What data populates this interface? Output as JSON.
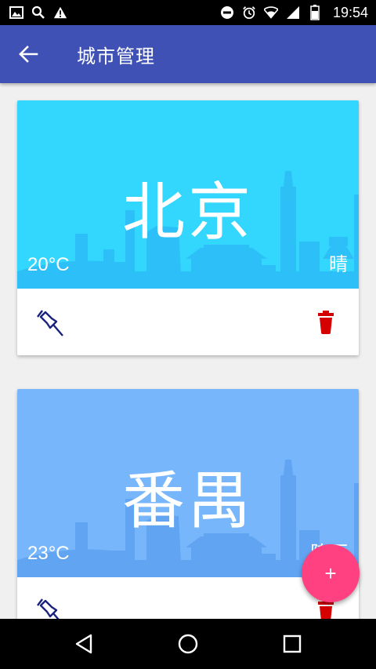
{
  "status_bar": {
    "time": "19:54",
    "left_icons": [
      "image-icon",
      "search-icon",
      "warning-icon"
    ],
    "right_icons": [
      "dnd-icon",
      "alarm-icon",
      "wifi-icon",
      "signal-icon",
      "battery-icon"
    ]
  },
  "app_bar": {
    "title": "城市管理",
    "back_icon": "arrow-back-icon"
  },
  "cities": [
    {
      "name": "北京",
      "temperature": "20°C",
      "weather": "晴",
      "banner_color": "#33d6fc",
      "pin_icon": "pushpin-icon",
      "delete_icon": "trash-icon"
    },
    {
      "name": "番禺",
      "temperature": "23°C",
      "weather": "阵雨",
      "banner_color": "#78b6fb",
      "pin_icon": "pushpin-icon",
      "delete_icon": "trash-icon"
    }
  ],
  "fab": {
    "label": "+",
    "color": "#ff4081"
  },
  "colors": {
    "primary": "#3f51b5",
    "pin": "#1a237e",
    "delete": "#d50000"
  },
  "nav_bar": {
    "buttons": [
      "back-triangle-icon",
      "home-circle-icon",
      "recents-square-icon"
    ]
  }
}
